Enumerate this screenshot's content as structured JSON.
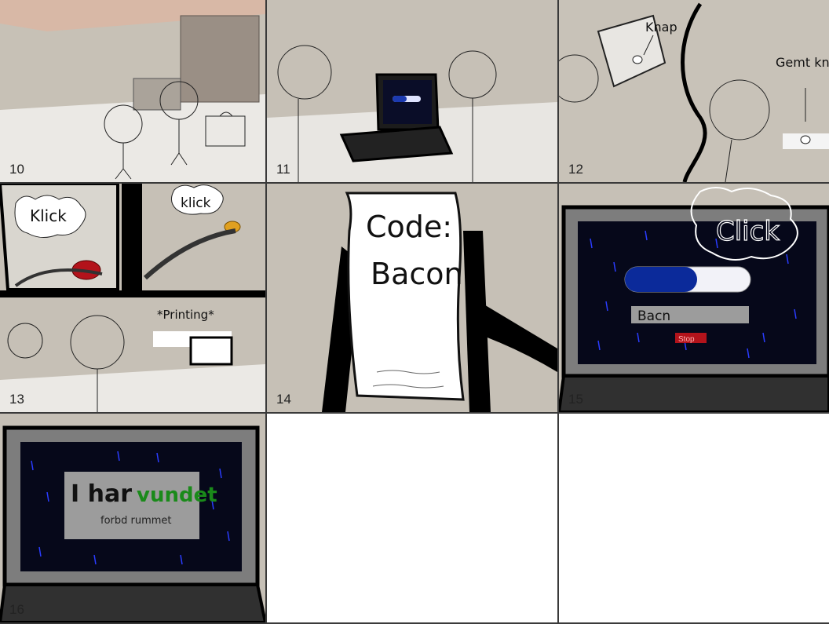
{
  "panels": [
    {
      "number": "10"
    },
    {
      "number": "11"
    },
    {
      "number": "12",
      "labels": {
        "knap": "Knap",
        "gemt_knap": "Gemt knap"
      }
    },
    {
      "number": "13",
      "labels": {
        "klick_left": "Klick",
        "klick_right": "klick",
        "printing": "*Printing*"
      }
    },
    {
      "number": "14",
      "labels": {
        "code_title": "Code:",
        "code_value": "Bacon"
      }
    },
    {
      "number": "15",
      "labels": {
        "click": "Click",
        "input_value": "Bacn",
        "stop": "Stop"
      }
    },
    {
      "number": "16",
      "labels": {
        "win_prefix": "I har",
        "win_word": "vundet",
        "win_sub": "forbd rummet"
      }
    }
  ],
  "colors": {
    "room_wall": "#c9c3b8",
    "room_floor": "#e9e7e3",
    "screen": "#06081a",
    "screen_rain": "#2a3cff",
    "progress_fill": "#0b2a9a",
    "button_red": "#b3131b",
    "win_green": "#1a8a1a",
    "light_yellow": "#e0a020"
  }
}
